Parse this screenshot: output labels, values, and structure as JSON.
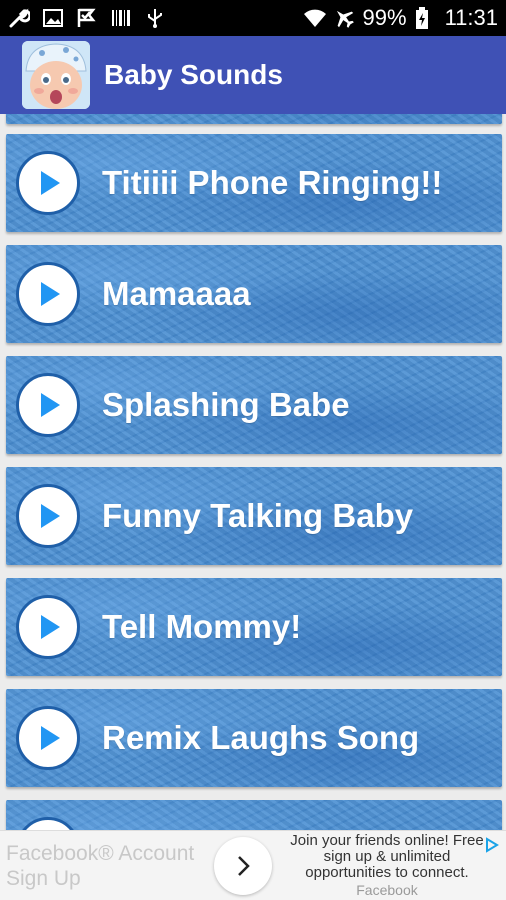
{
  "status_bar": {
    "battery_percent": "99%",
    "time": "11:31",
    "left_icons": [
      "wrench-icon",
      "image-icon",
      "check-flag-icon",
      "barcode-icon",
      "usb-icon"
    ],
    "right_icons": [
      "wifi-icon",
      "airplane-icon",
      "battery-icon"
    ]
  },
  "app_bar": {
    "title": "Baby Sounds",
    "logo": "baby-face-icon",
    "color": "#3f51b5"
  },
  "sounds": [
    {
      "label": "Titiiii Phone Ringing!!"
    },
    {
      "label": "Mamaaaa"
    },
    {
      "label": "Splashing Babe"
    },
    {
      "label": "Funny Talking Baby"
    },
    {
      "label": "Tell Mommy!"
    },
    {
      "label": "Remix Laughs Song"
    },
    {
      "label": ""
    }
  ],
  "ad": {
    "headline": "Facebook® Account Sign Up",
    "body": "Join your friends online! Free sign up & unlimited opportunities to connect.",
    "sponsor": "Facebook",
    "arrow_icon": "chevron-right-icon",
    "adchoices_icon": "adchoices-icon"
  },
  "colors": {
    "item_background": "#4b90d3",
    "play_ring": "#1f5fa8",
    "play_triangle": "#2196f3"
  }
}
